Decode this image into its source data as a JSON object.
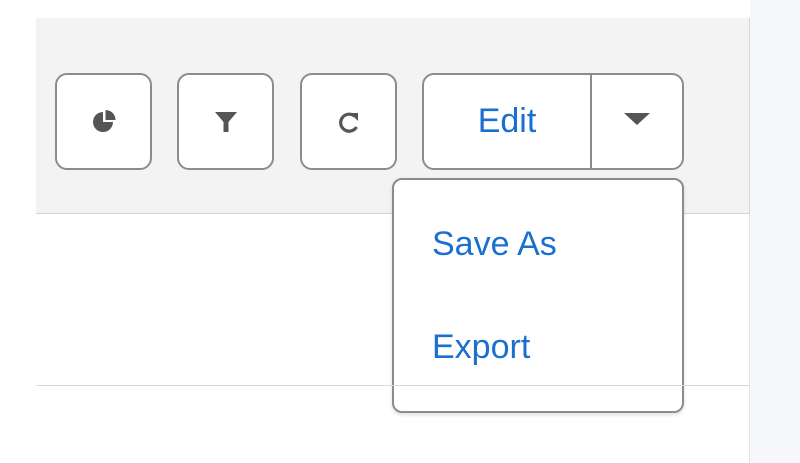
{
  "toolbar": {
    "chart_button": {
      "icon": "pie-chart-icon"
    },
    "filter_button": {
      "icon": "filter-icon"
    },
    "refresh_button": {
      "icon": "refresh-icon"
    },
    "edit_button": {
      "label": "Edit",
      "dropdown_icon": "caret-down-icon"
    }
  },
  "dropdown_menu": {
    "items": [
      {
        "label": "Save As"
      },
      {
        "label": "Export"
      }
    ]
  },
  "colors": {
    "link": "#1a6fd0",
    "icon": "#555555",
    "border": "#8c8c8c",
    "toolbar_bg": "#f3f3f3"
  }
}
